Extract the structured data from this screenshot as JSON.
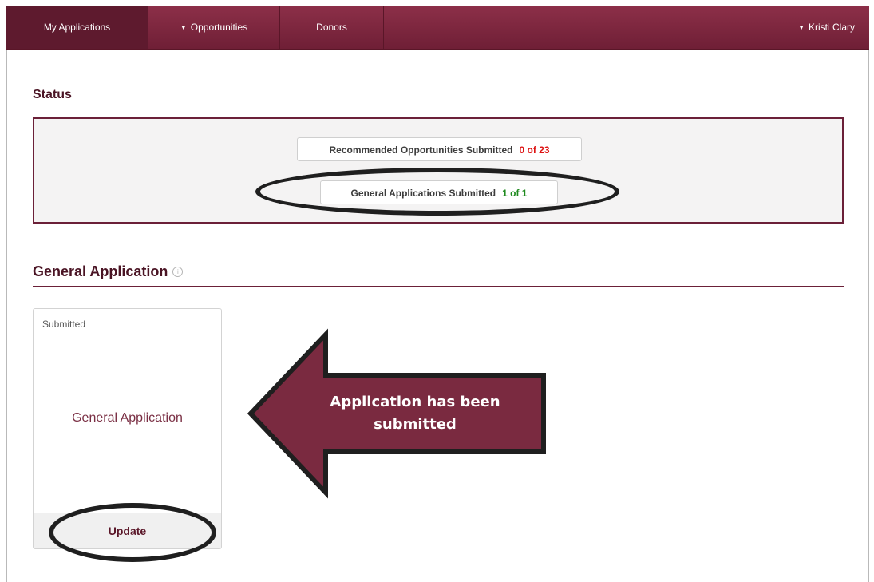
{
  "nav": {
    "items": [
      {
        "label": "My Applications",
        "caret": false
      },
      {
        "label": "Opportunities",
        "caret": true
      },
      {
        "label": "Donors",
        "caret": false
      }
    ],
    "caret_glyph": "▼",
    "user": "Kristi Clary"
  },
  "status": {
    "title": "Status",
    "recommended": {
      "label": "Recommended Opportunities Submitted",
      "count": "0 of 23"
    },
    "general": {
      "label": "General Applications Submitted",
      "count": "1 of 1"
    }
  },
  "general_application": {
    "title": "General Application",
    "info_glyph": "i",
    "card": {
      "status": "Submitted",
      "name": "General Application",
      "action": "Update"
    }
  },
  "callout": {
    "text": "Application has been submitted"
  },
  "colors": {
    "brand": "#7a2a40",
    "brand_dark": "#5a1628",
    "count_red": "#dd1111",
    "count_green": "#1e8a1e"
  }
}
